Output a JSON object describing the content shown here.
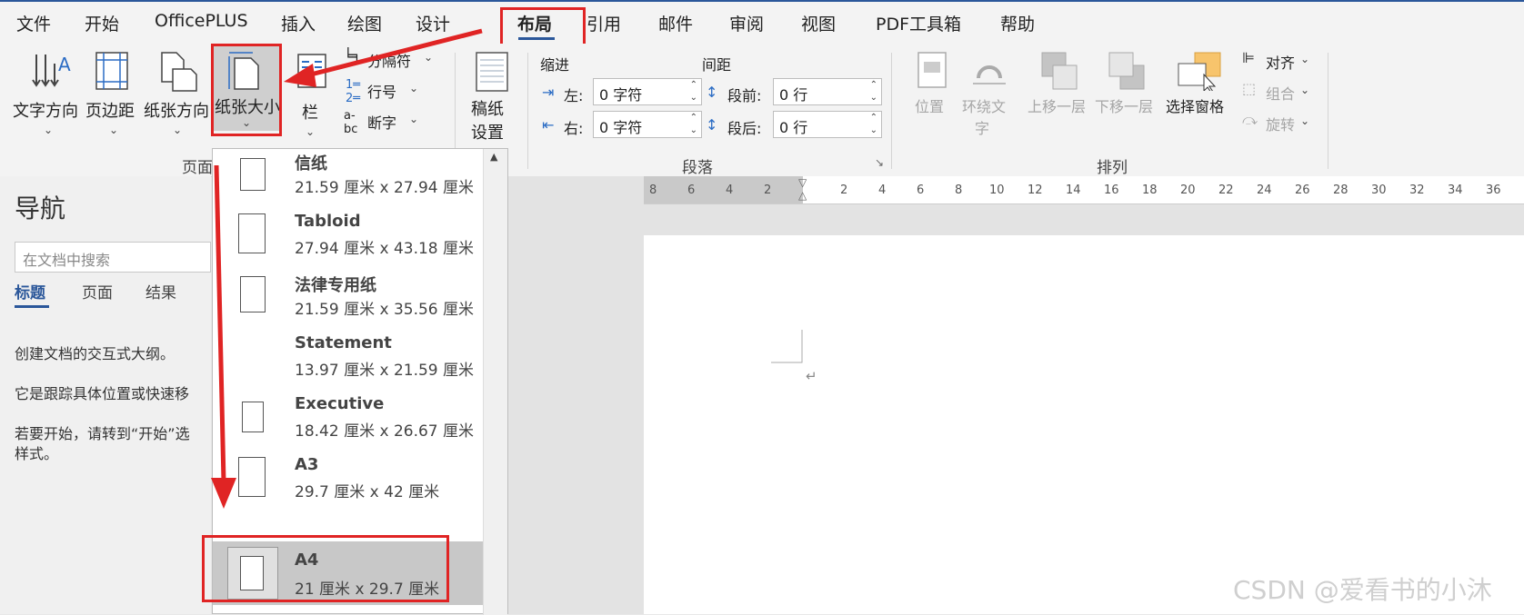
{
  "menubar": {
    "items": [
      "文件",
      "开始",
      "OfficePLUS",
      "插入",
      "绘图",
      "设计",
      "布局",
      "引用",
      "邮件",
      "审阅",
      "视图",
      "PDF工具箱",
      "帮助"
    ],
    "active": "布局"
  },
  "ribbon": {
    "page_setup": {
      "text_direction": "文字方向",
      "margins": "页边距",
      "orientation": "纸张方向",
      "size": "纸张大小",
      "columns": "栏",
      "breaks": "分隔符",
      "line_numbers": "行号",
      "hyphenation": "断字",
      "group_label": "页面"
    },
    "draft": {
      "label1": "稿纸",
      "label2": "设置"
    },
    "paragraph": {
      "indent_title": "缩进",
      "spacing_title": "间距",
      "left_label": "左:",
      "left_value": "0 字符",
      "right_label": "右:",
      "right_value": "0 字符",
      "before_label": "段前:",
      "before_value": "0 行",
      "after_label": "段后:",
      "after_value": "0 行",
      "group_label": "段落"
    },
    "arrange": {
      "position": "位置",
      "wrap_text1": "环绕文",
      "wrap_text2": "字",
      "bring_forward": "上移一层",
      "send_backward": "下移一层",
      "selection_pane": "选择窗格",
      "align": "对齐",
      "group": "组合",
      "rotate": "旋转",
      "group_label": "排列"
    }
  },
  "nav": {
    "title": "导航",
    "search_placeholder": "在文档中搜索",
    "tabs": [
      "标题",
      "页面",
      "结果"
    ],
    "text1": "创建文档的交互式大纲。",
    "text2": "它是跟踪具体位置或快速移",
    "text3": "若要开始，请转到“开始”选",
    "text4": "样式。"
  },
  "paper_sizes": [
    {
      "name": "信纸",
      "size": "21.59 厘米 x 27.94 厘米"
    },
    {
      "name": "Tabloid",
      "size": "27.94 厘米 x 43.18 厘米"
    },
    {
      "name": "法律专用纸",
      "size": "21.59 厘米 x 35.56 厘米"
    },
    {
      "name": "Statement",
      "size": "13.97 厘米 x 21.59 厘米"
    },
    {
      "name": "Executive",
      "size": "18.42 厘米 x 26.67 厘米"
    },
    {
      "name": "A3",
      "size": "29.7 厘米 x 42 厘米"
    },
    {
      "name": "A4",
      "size": "21 厘米 x 29.7 厘米"
    }
  ],
  "selected_paper": "A4",
  "ruler": {
    "left_marks": [
      "8",
      "6",
      "4",
      "2"
    ],
    "right_marks": [
      "2",
      "4",
      "6",
      "8",
      "10",
      "12",
      "14",
      "16",
      "18",
      "20",
      "22",
      "24",
      "26",
      "28",
      "30",
      "32",
      "34",
      "36"
    ]
  },
  "paragraph_mark": "↵",
  "watermark": "CSDN @爱看书的小沐",
  "colors": {
    "accent": "#2b579a",
    "highlight_box": "#e02424",
    "arrow": "#e02424"
  }
}
